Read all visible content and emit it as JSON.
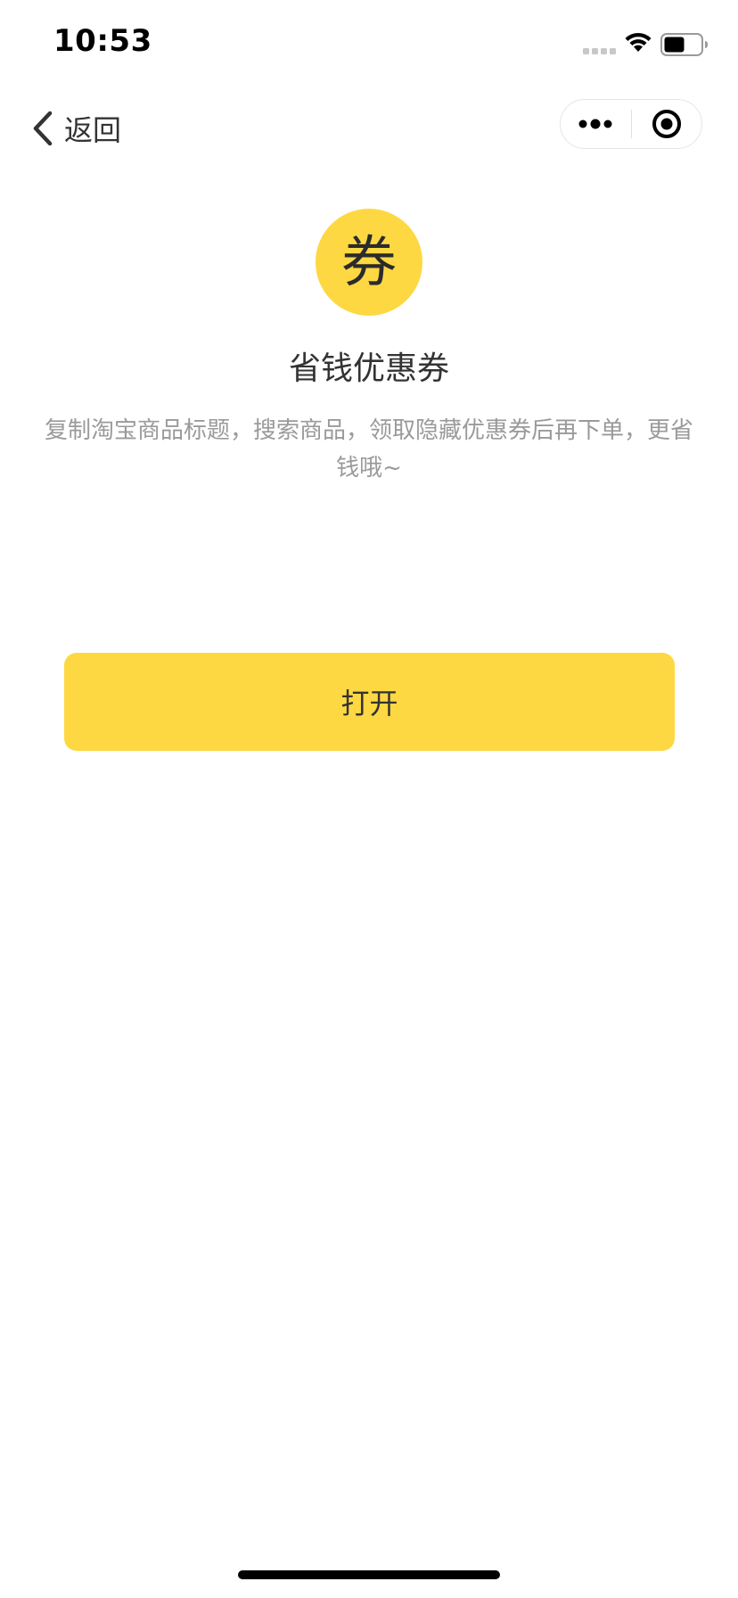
{
  "status_bar": {
    "time": "10:53",
    "icons": [
      "signal-icon",
      "wifi-icon",
      "battery-icon"
    ]
  },
  "nav": {
    "back_label": "返回",
    "icons": [
      "chevron-left-icon",
      "more-icon",
      "close-target-icon"
    ]
  },
  "main": {
    "badge_text": "券",
    "title": "省钱优惠券",
    "description": "复制淘宝商品标题，搜索商品，领取隐藏优惠券后再下单，更省钱哦~",
    "open_button_label": "打开"
  },
  "colors": {
    "accent": "#fdd843",
    "text_primary": "#333333",
    "text_secondary": "#9a9a9a"
  }
}
